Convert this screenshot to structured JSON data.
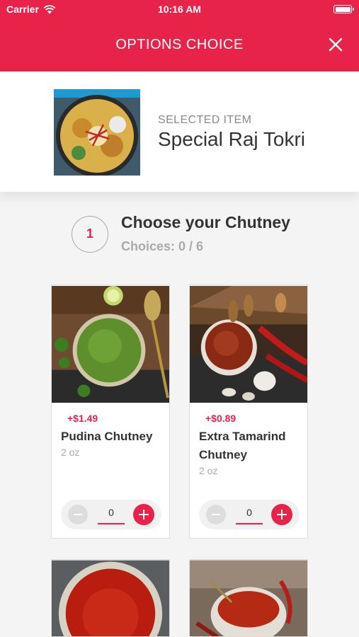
{
  "status_bar": {
    "carrier": "Carrier",
    "time": "10:16 AM"
  },
  "header": {
    "title": "OPTIONS CHOICE",
    "close_icon": "close-icon"
  },
  "selected": {
    "label": "SELECTED ITEM",
    "name": "Special Raj Tokri"
  },
  "section": {
    "step": "1",
    "title": "Choose your Chutney",
    "choices": "Choices: 0 / 6"
  },
  "items": [
    {
      "price": "+$1.49",
      "name": "Pudina Chutney",
      "size": "2 oz",
      "qty": "0"
    },
    {
      "price": "+$0.89",
      "name": "Extra Tamarind Chutney",
      "size": "2 oz",
      "qty": "0"
    }
  ],
  "colors": {
    "accent": "#e8234a"
  }
}
